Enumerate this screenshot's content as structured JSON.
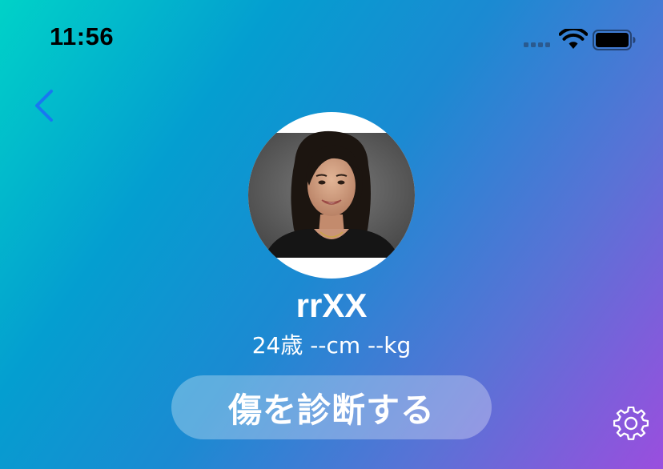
{
  "status_bar": {
    "time": "11:56",
    "icons": [
      "cellular-signal-icon",
      "wifi-icon",
      "battery-icon"
    ]
  },
  "nav": {
    "back_icon": "chevron-left-icon"
  },
  "profile": {
    "avatar_icon": "profile-photo",
    "name": "rrXX",
    "meta": "24歳 --cm --kg"
  },
  "actions": {
    "diagnose_label": "傷を診断する",
    "settings_icon": "gear-icon"
  },
  "colors": {
    "gradient_start": "#00d2c8",
    "gradient_mid": "#1b8ad2",
    "gradient_end": "#9a4ede",
    "back_chevron": "#1877f2",
    "text": "#ffffff"
  }
}
